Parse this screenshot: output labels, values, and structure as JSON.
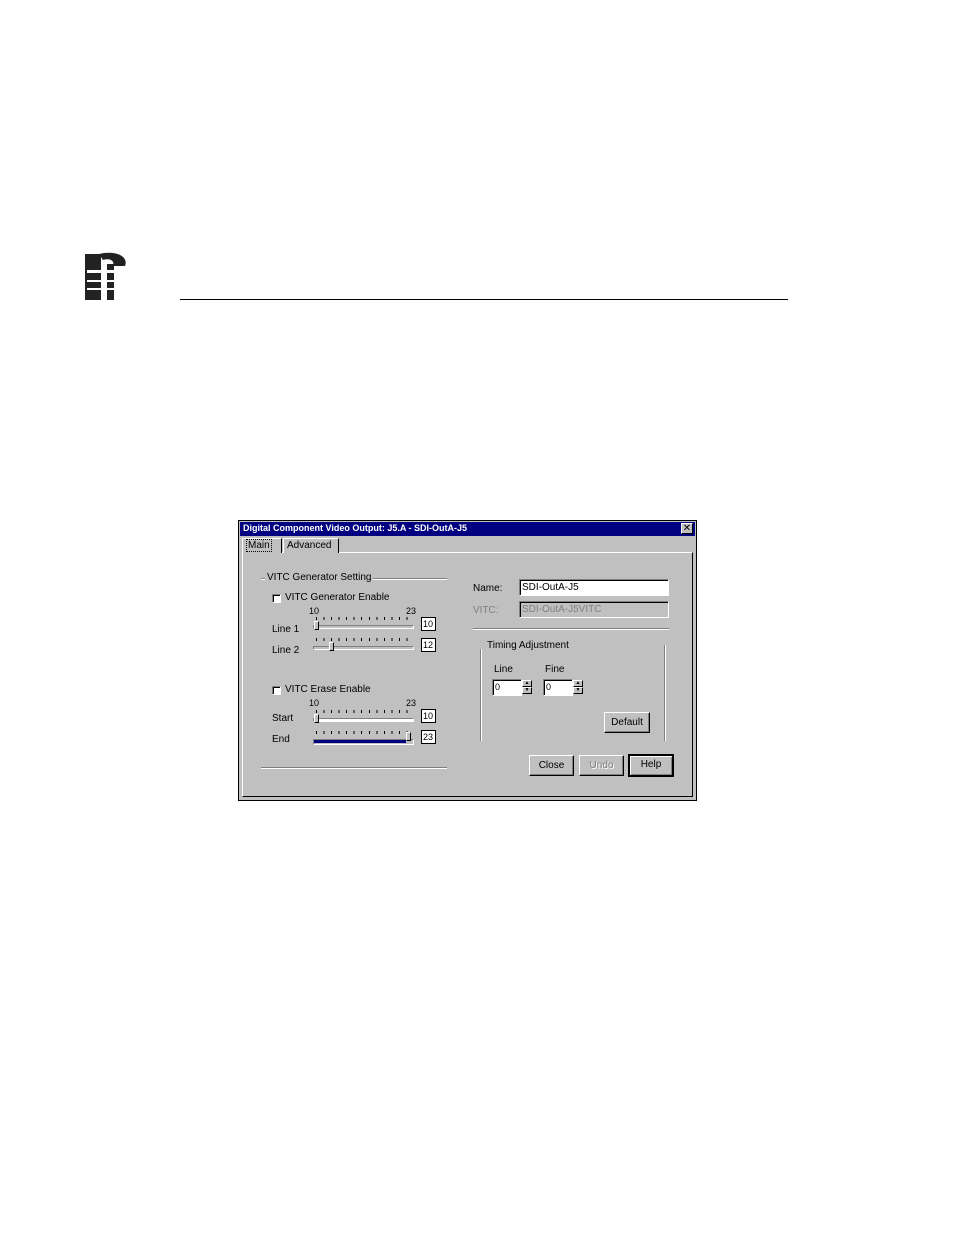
{
  "dialog": {
    "title": "Digital Component Video Output: J5.A - SDI-OutA-J5",
    "close_glyph": "✕",
    "tabs": [
      {
        "label": "Main"
      },
      {
        "label": "Advanced"
      }
    ]
  },
  "vitc_group": {
    "title": "VITC Generator Setting",
    "generator_enable_label": "VITC Generator Enable",
    "generator_scale_min": "10",
    "generator_scale_max": "23",
    "line1_label": "Line 1",
    "line1_value": "10",
    "line2_label": "Line 2",
    "line2_value": "12",
    "erase_enable_label": "VITC Erase Enable",
    "erase_scale_min": "10",
    "erase_scale_max": "23",
    "start_label": "Start",
    "start_value": "10",
    "end_label": "End",
    "end_value": "23"
  },
  "name_section": {
    "name_label": "Name:",
    "name_value": "SDI-OutA-J5",
    "vitc_label": "VITC:",
    "vitc_value": "SDI-OutA-J5VITC"
  },
  "timing": {
    "title": "Timing Adjustment",
    "line_label": "Line",
    "line_value": "0",
    "fine_label": "Fine",
    "fine_value": "0",
    "default_button": "Default"
  },
  "buttons": {
    "close": "Close",
    "undo": "Undo",
    "help": "Help"
  },
  "colors": {
    "titlebar": "#000080",
    "face": "#c0c0c0"
  }
}
